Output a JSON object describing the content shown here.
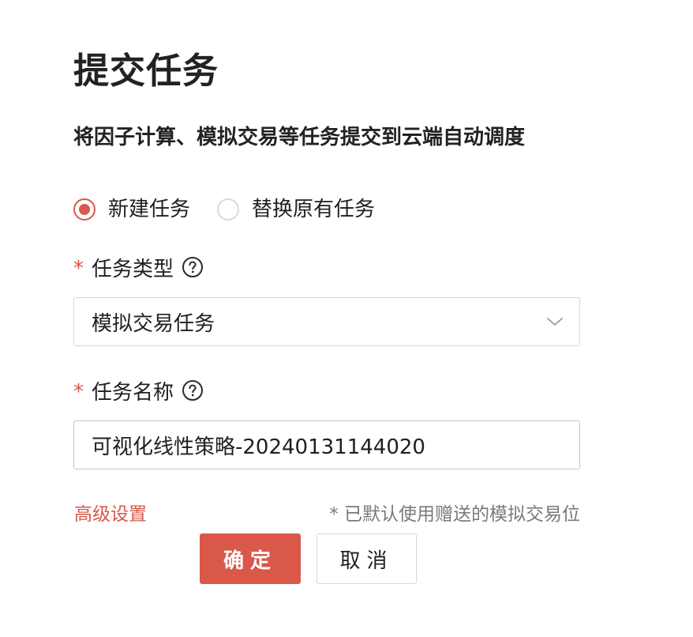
{
  "dialog": {
    "title": "提交任务",
    "subtitle": "将因子计算、模拟交易等任务提交到云端自动调度"
  },
  "mode_options": [
    {
      "label": "新建任务",
      "selected": true
    },
    {
      "label": "替换原有任务",
      "selected": false
    }
  ],
  "task_type": {
    "required_mark": "*",
    "label": "任务类型",
    "help_icon": "question-circle-icon",
    "selected_value": "模拟交易任务",
    "dropdown_icon": "chevron-down-icon"
  },
  "task_name": {
    "required_mark": "*",
    "label": "任务名称",
    "help_icon": "question-circle-icon",
    "value": "可视化线性策略-20240131144020"
  },
  "footer": {
    "advanced_settings": "高级设置",
    "note": "* 已默认使用赠送的模拟交易位"
  },
  "buttons": {
    "confirm": "确定",
    "cancel": "取消"
  },
  "colors": {
    "accent": "#d9584a",
    "border": "#d6d6d6",
    "muted_text": "#7a7a7a"
  }
}
